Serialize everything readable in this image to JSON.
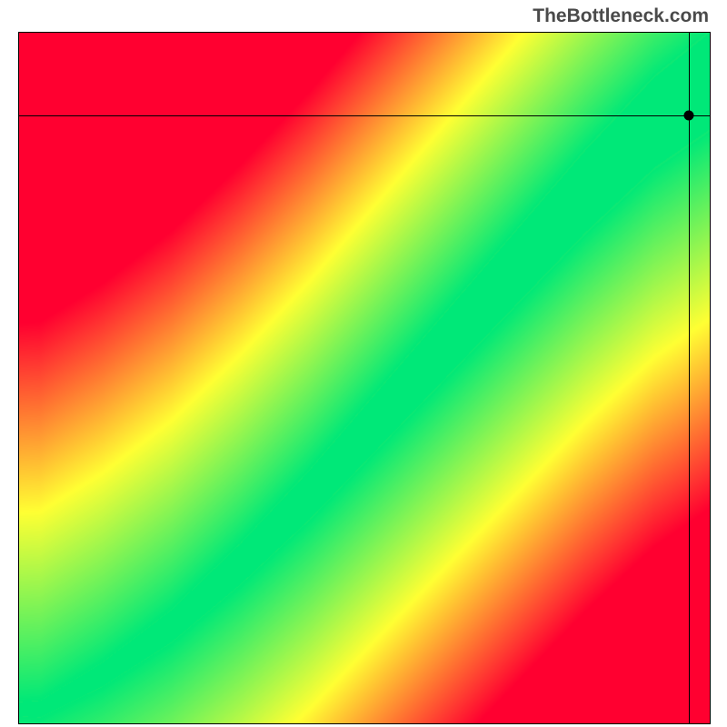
{
  "watermark": "TheBottleneck.com",
  "chart_data": {
    "type": "heatmap",
    "title": "",
    "xlabel": "",
    "ylabel": "",
    "xlim": [
      0,
      100
    ],
    "ylim": [
      0,
      100
    ],
    "colorscale": {
      "low": "#ff0030",
      "mid": "#ffff33",
      "high": "#00e878",
      "meaning": "red = heavy bottleneck, yellow = moderate, green = balanced"
    },
    "optimal_band": {
      "description": "approximate centerline of the green optimal-match ridge (x,y as % of axis)",
      "points": [
        {
          "x": 3,
          "y": 2
        },
        {
          "x": 12,
          "y": 7
        },
        {
          "x": 22,
          "y": 14
        },
        {
          "x": 32,
          "y": 23
        },
        {
          "x": 42,
          "y": 33
        },
        {
          "x": 52,
          "y": 44
        },
        {
          "x": 62,
          "y": 55
        },
        {
          "x": 72,
          "y": 66
        },
        {
          "x": 82,
          "y": 77
        },
        {
          "x": 92,
          "y": 87
        },
        {
          "x": 100,
          "y": 93
        }
      ],
      "width_percent_at_start": 2,
      "width_percent_at_end": 14
    },
    "marker": {
      "x": 97,
      "y": 88,
      "note": "crosshair intersection / selected configuration"
    }
  }
}
